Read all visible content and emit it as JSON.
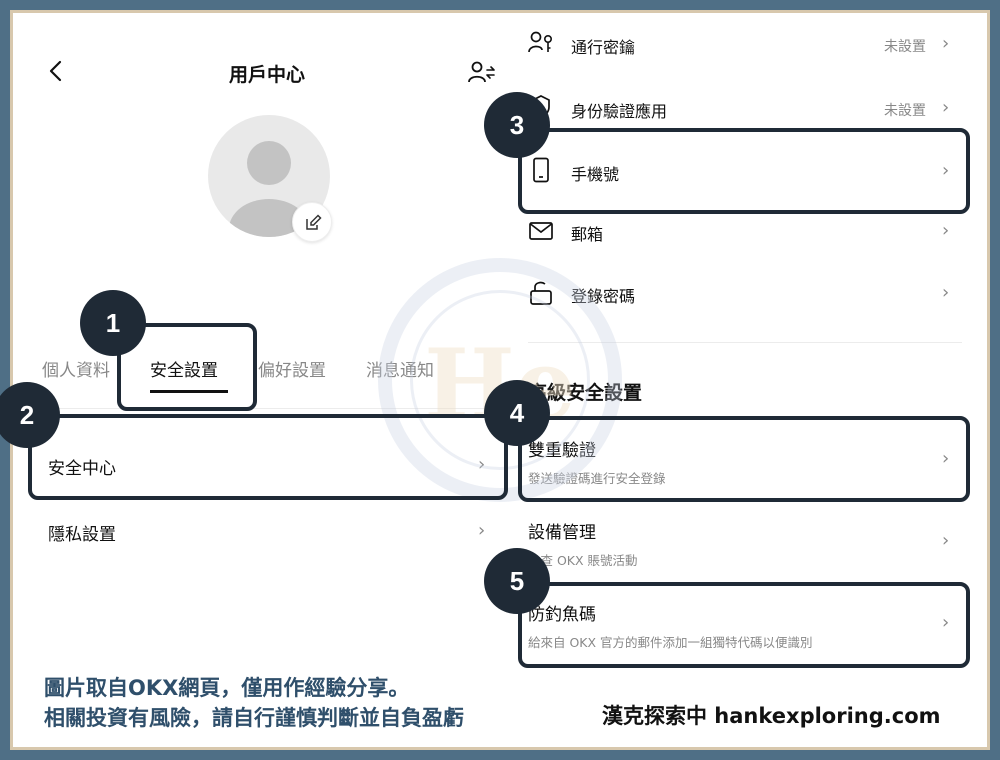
{
  "header": {
    "title": "用戶中心"
  },
  "tabs": [
    {
      "label": "個人資料"
    },
    {
      "label": "安全設置"
    },
    {
      "label": "偏好設置"
    },
    {
      "label": "消息通知"
    }
  ],
  "left_menu": [
    {
      "label": "安全中心"
    },
    {
      "label": "隱私設置"
    }
  ],
  "security_items": [
    {
      "label": "通行密鑰",
      "status": "未設置"
    },
    {
      "label": "身份驗證應用",
      "status": "未設置"
    },
    {
      "label": "手機號"
    },
    {
      "label": "郵箱"
    },
    {
      "label": "登錄密碼"
    }
  ],
  "advanced": {
    "title": "高級安全設置",
    "items": [
      {
        "label": "雙重驗證",
        "desc": "發送驗證碼進行安全登錄"
      },
      {
        "label": "設備管理",
        "desc": "檢查 OKX 賬號活動"
      },
      {
        "label": "防釣魚碼",
        "desc": "給來自 OKX 官方的郵件添加一組獨特代碼以便識別"
      }
    ]
  },
  "badges": [
    "1",
    "2",
    "3",
    "4",
    "5"
  ],
  "captions": {
    "line1": "圖片取自OKX網頁，僅用作經驗分享。",
    "line2": "相關投資有風險，請自行謹慎判斷並自負盈虧",
    "brand": "漢克探索中 hankexploring.com"
  },
  "watermark": {
    "text": "He"
  },
  "colors": {
    "frame": "#4f6f86",
    "frame_accent": "#d8c8ad",
    "highlight": "#1f2a36",
    "caption": "#2f4f6b"
  }
}
